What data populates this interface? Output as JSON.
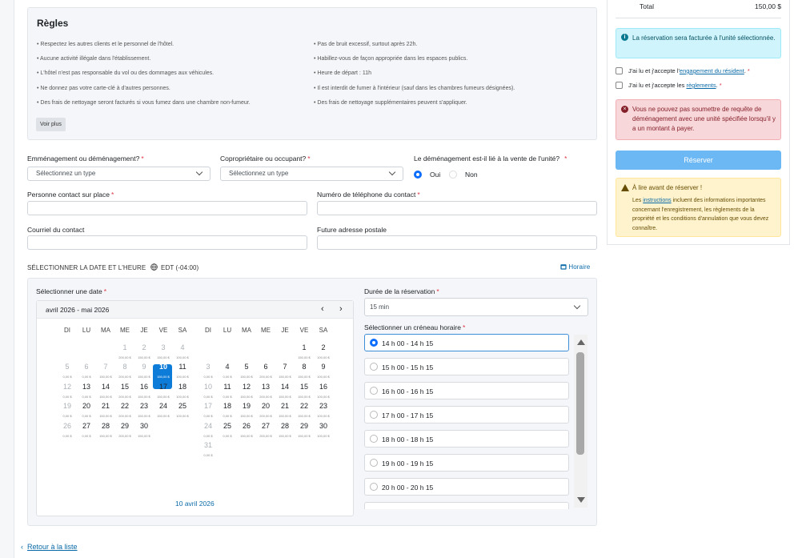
{
  "rules": {
    "title": "Règles",
    "left": [
      "• Respectez les autres clients et le personnel de l'hôtel.",
      "• Aucune activité illégale dans l'établissement.",
      "• L'hôtel n'est pas responsable du vol ou des dommages aux véhicules.",
      "• Ne donnez pas votre carte-clé à d'autres personnes.",
      "• Des frais de nettoyage seront facturés si vous fumez dans une chambre non-fumeur."
    ],
    "right": [
      "• Pas de bruit excessif, surtout après 22h.",
      "• Habillez-vous de façon appropriée dans les espaces publics.",
      "• Heure de départ : 11h",
      "• Il est interdit de fumer à l'intérieur (sauf dans les chambres fumeurs désignées).",
      "• Des frais de nettoyage supplémentaires peuvent s'appliquer."
    ],
    "more": "Voir plus"
  },
  "form": {
    "move_label": "Emménagement ou déménagement?",
    "move_placeholder": "Sélectionnez un type",
    "owner_label": "Copropriétaire ou occupant?",
    "owner_placeholder": "Sélectionnez un type",
    "sale_label": "Le déménagement est-il lié à la vente de l'unité?",
    "yes": "Oui",
    "no": "Non",
    "contact_label": "Personne contact sur place",
    "phone_label": "Numéro de téléphone du contact",
    "email_label": "Courriel du contact",
    "address_label": "Future adresse postale",
    "required": "*"
  },
  "schedule": {
    "section": "SÉLECTIONNER LA DATE ET L'HEURE",
    "timezone": "EDT (-04:00)",
    "horaire": "Horaire",
    "select_date": "Sélectionner une date",
    "range": "avril 2026 - mai 2026",
    "selected_date": "10 avril 2026",
    "duration_label": "Durée de la réservation",
    "duration_value": "15 min",
    "slot_label": "Sélectionner un créneau horaire",
    "slots": [
      "14 h 00 - 14 h 15",
      "15 h 00 - 15 h 15",
      "16 h 00 - 16 h 15",
      "17 h 00 - 17 h 15",
      "18 h 00 - 18 h 15",
      "19 h 00 - 19 h 15",
      "20 h 00 - 20 h 15"
    ],
    "dow": [
      "DI",
      "LU",
      "MA",
      "ME",
      "JE",
      "VE",
      "SA"
    ]
  },
  "calendar": {
    "april": [
      [
        null,
        null,
        null,
        [
          "1",
          "200,00 $",
          1
        ],
        [
          "2",
          "150,00 $",
          1
        ],
        [
          "3",
          "150,00 $",
          1
        ],
        [
          "4",
          "100,00 $",
          1
        ]
      ],
      [
        [
          "5",
          "0,00 $",
          1
        ],
        [
          "6",
          "0,00 $",
          1
        ],
        [
          "7",
          "150,00 $",
          1
        ],
        [
          "8",
          "200,00 $",
          1
        ],
        [
          "9",
          "150,00 $",
          1
        ],
        [
          "10",
          "150,00 $",
          2
        ],
        [
          "11",
          "100,00 $",
          0
        ]
      ],
      [
        [
          "12",
          "0,00 $",
          1
        ],
        [
          "13",
          "0,00 $",
          0
        ],
        [
          "14",
          "150,00 $",
          0
        ],
        [
          "15",
          "200,00 $",
          0
        ],
        [
          "16",
          "150,00 $",
          0
        ],
        [
          "17",
          "150,00 $",
          0
        ],
        [
          "18",
          "100,00 $",
          0
        ]
      ],
      [
        [
          "19",
          "0,00 $",
          1
        ],
        [
          "20",
          "0,00 $",
          0
        ],
        [
          "21",
          "150,00 $",
          0
        ],
        [
          "22",
          "200,00 $",
          0
        ],
        [
          "23",
          "150,00 $",
          0
        ],
        [
          "24",
          "150,00 $",
          0
        ],
        [
          "25",
          "100,00 $",
          0
        ]
      ],
      [
        [
          "26",
          "0,00 $",
          1
        ],
        [
          "27",
          "0,00 $",
          0
        ],
        [
          "28",
          "150,00 $",
          0
        ],
        [
          "29",
          "200,00 $",
          0
        ],
        [
          "30",
          "150,00 $",
          0
        ],
        null,
        null
      ]
    ],
    "may": [
      [
        null,
        null,
        null,
        null,
        null,
        [
          "1",
          "150,00 $",
          0
        ],
        [
          "2",
          "100,00 $",
          0
        ]
      ],
      [
        [
          "3",
          "0,00 $",
          1
        ],
        [
          "4",
          "0,00 $",
          0
        ],
        [
          "5",
          "150,00 $",
          0
        ],
        [
          "6",
          "200,00 $",
          0
        ],
        [
          "7",
          "150,00 $",
          0
        ],
        [
          "8",
          "150,00 $",
          0
        ],
        [
          "9",
          "100,00 $",
          0
        ]
      ],
      [
        [
          "10",
          "0,00 $",
          1
        ],
        [
          "11",
          "0,00 $",
          0
        ],
        [
          "12",
          "150,00 $",
          0
        ],
        [
          "13",
          "200,00 $",
          0
        ],
        [
          "14",
          "150,00 $",
          0
        ],
        [
          "15",
          "150,00 $",
          0
        ],
        [
          "16",
          "100,00 $",
          0
        ]
      ],
      [
        [
          "17",
          "0,00 $",
          1
        ],
        [
          "18",
          "0,00 $",
          0
        ],
        [
          "19",
          "150,00 $",
          0
        ],
        [
          "20",
          "200,00 $",
          0
        ],
        [
          "21",
          "150,00 $",
          0
        ],
        [
          "22",
          "150,00 $",
          0
        ],
        [
          "23",
          "100,00 $",
          0
        ]
      ],
      [
        [
          "24",
          "0,00 $",
          1
        ],
        [
          "25",
          "0,00 $",
          0
        ],
        [
          "26",
          "150,00 $",
          0
        ],
        [
          "27",
          "200,00 $",
          0
        ],
        [
          "28",
          "150,00 $",
          0
        ],
        [
          "29",
          "150,00 $",
          0
        ],
        [
          "30",
          "100,00 $",
          0
        ]
      ],
      [
        [
          "31",
          "0,00 $",
          1
        ],
        null,
        null,
        null,
        null,
        null,
        null
      ]
    ]
  },
  "summary": {
    "total_label": "Total",
    "total_value": "150,00 $",
    "info": "La réservation sera facturée à l'unité sélectionnée.",
    "chk1_pre": "J'ai lu et j'accepte l'",
    "chk1_link": "engagement du résident",
    "chk2_pre": "J'ai lu et j'accepte les ",
    "chk2_link": "règlements",
    "danger": "Vous ne pouvez pas soumettre de requête de déménagement avec une unité spécifiée lorsqu'il y a un montant à payer.",
    "reserve": "Réserver",
    "warn_title": "À lire avant de réserver !",
    "warn_pre": "Les ",
    "warn_link": "instructions",
    "warn_post": " incluent des informations importantes concernant l'enregistrement, les règlements de la propriété et les conditions d'annulation que vous devez connaître."
  },
  "back": "Retour à la liste"
}
